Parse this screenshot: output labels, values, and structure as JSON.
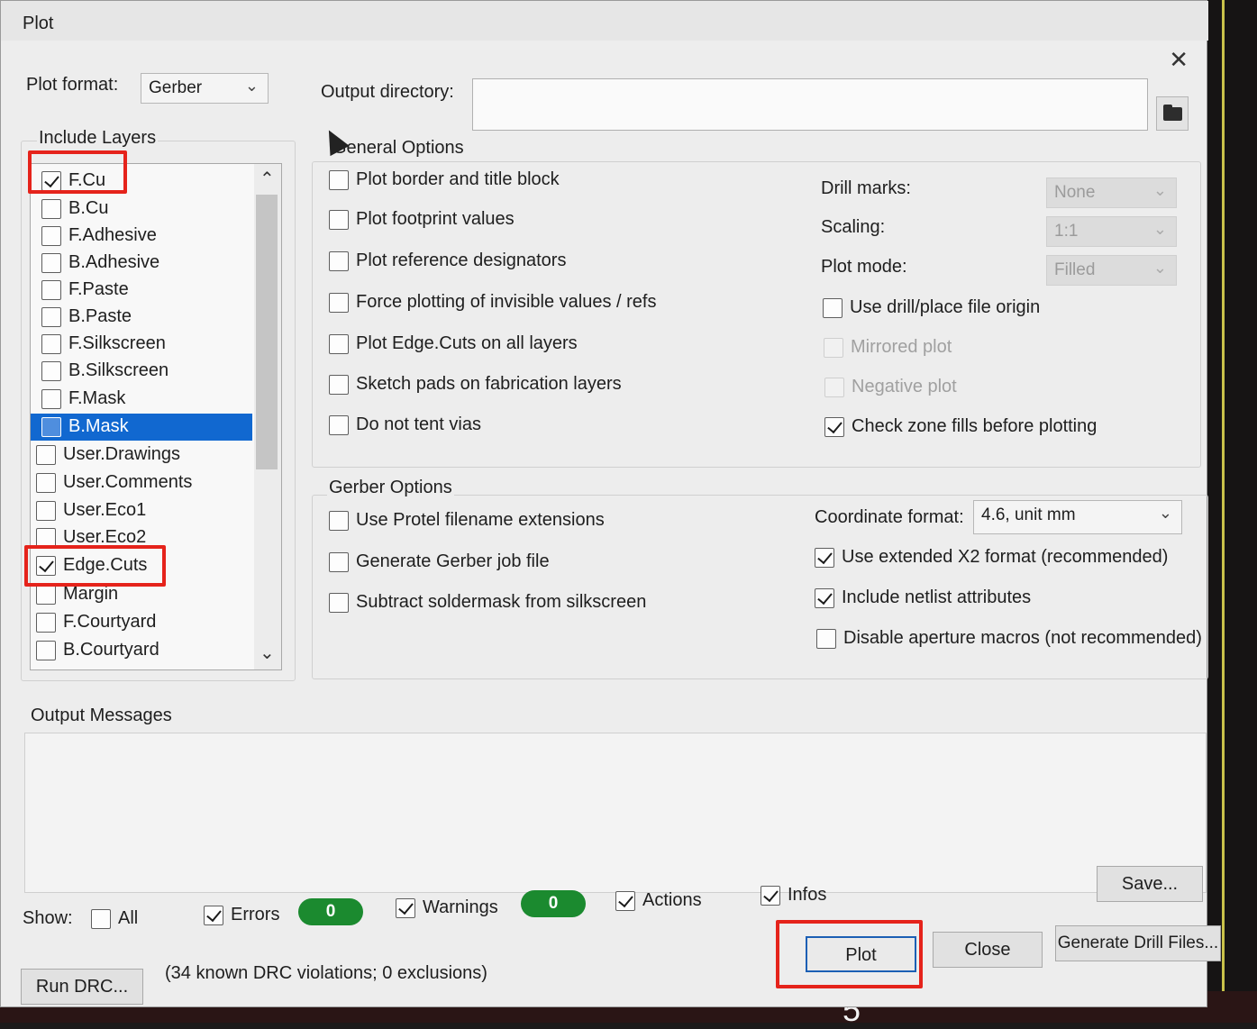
{
  "window": {
    "title": "Plot"
  },
  "plot_format": {
    "label": "Plot format:",
    "value": "Gerber"
  },
  "output_directory": {
    "label": "Output directory:",
    "value": ""
  },
  "include_layers": {
    "heading": "Include Layers",
    "items": [
      {
        "label": "F.Cu",
        "checked": true
      },
      {
        "label": "B.Cu",
        "checked": false
      },
      {
        "label": "F.Adhesive",
        "checked": false
      },
      {
        "label": "B.Adhesive",
        "checked": false
      },
      {
        "label": "F.Paste",
        "checked": false
      },
      {
        "label": "B.Paste",
        "checked": false
      },
      {
        "label": "F.Silkscreen",
        "checked": false
      },
      {
        "label": "B.Silkscreen",
        "checked": false
      },
      {
        "label": "F.Mask",
        "checked": false
      },
      {
        "label": "B.Mask",
        "checked": false,
        "selected": true
      },
      {
        "label": "User.Drawings",
        "checked": false
      },
      {
        "label": "User.Comments",
        "checked": false
      },
      {
        "label": "User.Eco1",
        "checked": false
      },
      {
        "label": "User.Eco2",
        "checked": false
      },
      {
        "label": "Edge.Cuts",
        "checked": true
      },
      {
        "label": "Margin",
        "checked": false
      },
      {
        "label": "F.Courtyard",
        "checked": false
      },
      {
        "label": "B.Courtyard",
        "checked": false
      }
    ]
  },
  "general_options": {
    "heading": "General Options",
    "options": [
      {
        "label": "Plot border and title block",
        "checked": false
      },
      {
        "label": "Plot footprint values",
        "checked": false
      },
      {
        "label": "Plot reference designators",
        "checked": false
      },
      {
        "label": "Force plotting of invisible values / refs",
        "checked": false
      },
      {
        "label": "Plot Edge.Cuts on all layers",
        "checked": false
      },
      {
        "label": "Sketch pads on fabrication layers",
        "checked": false
      },
      {
        "label": "Do not tent vias",
        "checked": false
      }
    ],
    "drill_marks": {
      "label": "Drill marks:",
      "value": "None"
    },
    "scaling": {
      "label": "Scaling:",
      "value": "1:1"
    },
    "plot_mode": {
      "label": "Plot mode:",
      "value": "Filled"
    },
    "right_options": [
      {
        "label": "Use drill/place file origin",
        "checked": false,
        "disabled": false
      },
      {
        "label": "Mirrored plot",
        "checked": false,
        "disabled": true
      },
      {
        "label": "Negative plot",
        "checked": false,
        "disabled": true
      },
      {
        "label": "Check zone fills before plotting",
        "checked": true,
        "disabled": false
      }
    ]
  },
  "gerber_options": {
    "heading": "Gerber Options",
    "options": [
      {
        "label": "Use Protel filename extensions",
        "checked": false
      },
      {
        "label": "Generate Gerber job file",
        "checked": false
      },
      {
        "label": "Subtract soldermask from silkscreen",
        "checked": false
      }
    ],
    "coordinate_format": {
      "label": "Coordinate format:",
      "value": "4.6, unit mm"
    },
    "right_options": [
      {
        "label": "Use extended X2 format (recommended)",
        "checked": true
      },
      {
        "label": "Include netlist attributes",
        "checked": true
      },
      {
        "label": "Disable aperture macros (not recommended)",
        "checked": false
      }
    ]
  },
  "output_messages": {
    "heading": "Output Messages",
    "show_label": "Show:",
    "filters": {
      "all": {
        "label": "All",
        "checked": false
      },
      "errors": {
        "label": "Errors",
        "checked": true,
        "count": "0"
      },
      "warnings": {
        "label": "Warnings",
        "checked": true,
        "count": "0"
      },
      "actions": {
        "label": "Actions",
        "checked": true
      },
      "infos": {
        "label": "Infos",
        "checked": true
      }
    },
    "save_button": "Save..."
  },
  "buttons": {
    "run_drc": "Run DRC...",
    "plot": "Plot",
    "close": "Close",
    "generate_drill": "Generate Drill Files..."
  },
  "drc_status": "(34 known DRC violations; 0 exclusions)",
  "background": {
    "board_digit": "5"
  },
  "colors": {
    "highlight": "#e5231b",
    "selection": "#1168d0",
    "count_badge": "#1b8a2f",
    "default_button_border": "#1c5fb4"
  }
}
